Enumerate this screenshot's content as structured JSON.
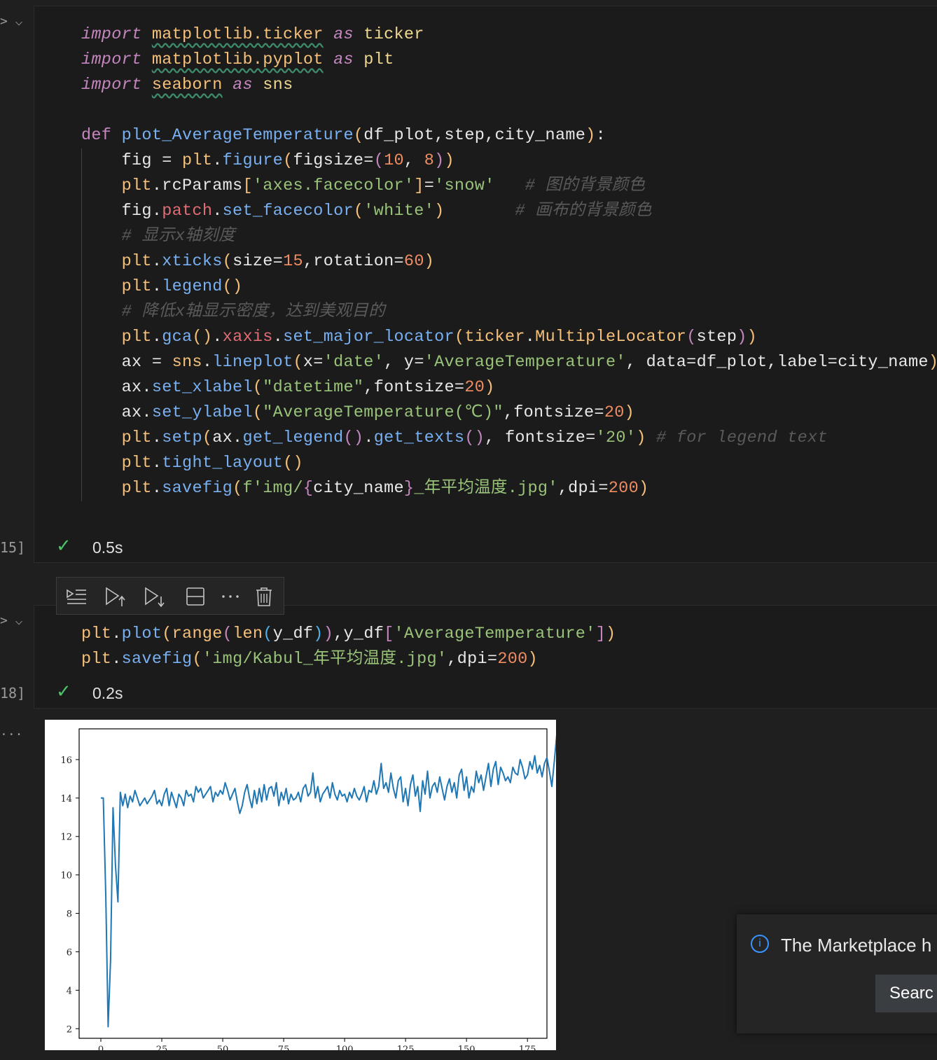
{
  "cell1": {
    "exec_count": "15]",
    "duration": "0.5s",
    "lines": [
      [
        [
          "kw",
          "import"
        ],
        [
          "var",
          " "
        ],
        [
          "mod",
          "matplotlib.ticker"
        ],
        [
          "var",
          " "
        ],
        [
          "kw",
          "as"
        ],
        [
          "var",
          " "
        ],
        [
          "alias",
          "ticker"
        ]
      ],
      [
        [
          "kw",
          "import"
        ],
        [
          "var",
          " "
        ],
        [
          "mod",
          "matplotlib.pyplot"
        ],
        [
          "var",
          " "
        ],
        [
          "kw",
          "as"
        ],
        [
          "var",
          " "
        ],
        [
          "alias",
          "plt"
        ]
      ],
      [
        [
          "kw",
          "import"
        ],
        [
          "var",
          " "
        ],
        [
          "mod",
          "seaborn"
        ],
        [
          "var",
          " "
        ],
        [
          "kw",
          "as"
        ],
        [
          "var",
          " "
        ],
        [
          "alias",
          "sns"
        ]
      ],
      [],
      [
        [
          "def",
          "def"
        ],
        [
          "var",
          " "
        ],
        [
          "fn",
          "plot_AverageTemperature"
        ],
        [
          "br1",
          "("
        ],
        [
          "var",
          "df_plot,step,city_name"
        ],
        [
          "br1",
          ")"
        ],
        [
          "var",
          ":"
        ]
      ],
      [
        [
          "var",
          "    fig = "
        ],
        [
          "obj",
          "plt"
        ],
        [
          "var",
          "."
        ],
        [
          "fn",
          "figure"
        ],
        [
          "br1",
          "("
        ],
        [
          "var",
          "figsize="
        ],
        [
          "br2",
          "("
        ],
        [
          "num",
          "10"
        ],
        [
          "var",
          ", "
        ],
        [
          "num",
          "8"
        ],
        [
          "br2",
          ")"
        ],
        [
          "br1",
          ")"
        ]
      ],
      [
        [
          "var",
          "    "
        ],
        [
          "obj",
          "plt"
        ],
        [
          "var",
          ".rcParams"
        ],
        [
          "br1",
          "["
        ],
        [
          "str",
          "'axes.facecolor'"
        ],
        [
          "br1",
          "]"
        ],
        [
          "var",
          "="
        ],
        [
          "str",
          "'snow'"
        ],
        [
          "var",
          "   "
        ],
        [
          "cm",
          "# 图的背景颜色"
        ]
      ],
      [
        [
          "var",
          "    fig."
        ],
        [
          "attr",
          "patch"
        ],
        [
          "var",
          "."
        ],
        [
          "fn",
          "set_facecolor"
        ],
        [
          "br1",
          "("
        ],
        [
          "str",
          "'white'"
        ],
        [
          "br1",
          ")"
        ],
        [
          "var",
          "       "
        ],
        [
          "cm",
          "# 画布的背景颜色"
        ]
      ],
      [
        [
          "var",
          "    "
        ],
        [
          "cm",
          "# 显示x轴刻度"
        ]
      ],
      [
        [
          "var",
          "    "
        ],
        [
          "obj",
          "plt"
        ],
        [
          "var",
          "."
        ],
        [
          "fn",
          "xticks"
        ],
        [
          "br1",
          "("
        ],
        [
          "var",
          "size="
        ],
        [
          "num",
          "15"
        ],
        [
          "var",
          ",rotation="
        ],
        [
          "num",
          "60"
        ],
        [
          "br1",
          ")"
        ]
      ],
      [
        [
          "var",
          "    "
        ],
        [
          "obj",
          "plt"
        ],
        [
          "var",
          "."
        ],
        [
          "fn",
          "legend"
        ],
        [
          "br1",
          "()"
        ]
      ],
      [
        [
          "var",
          "    "
        ],
        [
          "cm",
          "# 降低x轴显示密度，达到美观目的"
        ]
      ],
      [
        [
          "var",
          "    "
        ],
        [
          "obj",
          "plt"
        ],
        [
          "var",
          "."
        ],
        [
          "fn",
          "gca"
        ],
        [
          "br1",
          "()"
        ],
        [
          "var",
          "."
        ],
        [
          "attr",
          "xaxis"
        ],
        [
          "var",
          "."
        ],
        [
          "fn",
          "set_major_locator"
        ],
        [
          "br1",
          "("
        ],
        [
          "obj",
          "ticker"
        ],
        [
          "var",
          "."
        ],
        [
          "obj",
          "MultipleLocator"
        ],
        [
          "br2",
          "("
        ],
        [
          "var",
          "step"
        ],
        [
          "br2",
          ")"
        ],
        [
          "br1",
          ")"
        ]
      ],
      [
        [
          "var",
          "    ax = "
        ],
        [
          "obj",
          "sns"
        ],
        [
          "var",
          "."
        ],
        [
          "fn",
          "lineplot"
        ],
        [
          "br1",
          "("
        ],
        [
          "var",
          "x="
        ],
        [
          "str",
          "'date'"
        ],
        [
          "var",
          ", y="
        ],
        [
          "str",
          "'AverageTemperature'"
        ],
        [
          "var",
          ", data=df_plot,label=city_name"
        ],
        [
          "br1",
          ")"
        ]
      ],
      [
        [
          "var",
          "    ax."
        ],
        [
          "fn",
          "set_xlabel"
        ],
        [
          "br1",
          "("
        ],
        [
          "str",
          "\"datetime\""
        ],
        [
          "var",
          ",fontsize="
        ],
        [
          "num",
          "20"
        ],
        [
          "br1",
          ")"
        ]
      ],
      [
        [
          "var",
          "    ax."
        ],
        [
          "fn",
          "set_ylabel"
        ],
        [
          "br1",
          "("
        ],
        [
          "str",
          "\"AverageTemperature(℃)\""
        ],
        [
          "var",
          ",fontsize="
        ],
        [
          "num",
          "20"
        ],
        [
          "br1",
          ")"
        ]
      ],
      [
        [
          "var",
          "    "
        ],
        [
          "obj",
          "plt"
        ],
        [
          "var",
          "."
        ],
        [
          "fn",
          "setp"
        ],
        [
          "br1",
          "("
        ],
        [
          "var",
          "ax."
        ],
        [
          "fn",
          "get_legend"
        ],
        [
          "br2",
          "()"
        ],
        [
          "var",
          "."
        ],
        [
          "fn",
          "get_texts"
        ],
        [
          "br2",
          "()"
        ],
        [
          "var",
          ", fontsize="
        ],
        [
          "str",
          "'20'"
        ],
        [
          "br1",
          ")"
        ],
        [
          "var",
          " "
        ],
        [
          "cm",
          "# for legend text"
        ]
      ],
      [
        [
          "var",
          "    "
        ],
        [
          "obj",
          "plt"
        ],
        [
          "var",
          "."
        ],
        [
          "fn",
          "tight_layout"
        ],
        [
          "br1",
          "()"
        ]
      ],
      [
        [
          "var",
          "    "
        ],
        [
          "obj",
          "plt"
        ],
        [
          "var",
          "."
        ],
        [
          "fn",
          "savefig"
        ],
        [
          "br1",
          "("
        ],
        [
          "str",
          "f'img/"
        ],
        [
          "br2",
          "{"
        ],
        [
          "var",
          "city_name"
        ],
        [
          "br2",
          "}"
        ],
        [
          "str",
          "_年平均温度.jpg'"
        ],
        [
          "var",
          ",dpi="
        ],
        [
          "num",
          "200"
        ],
        [
          "br1",
          ")"
        ]
      ]
    ]
  },
  "cell2": {
    "exec_count": "18]",
    "duration": "0.2s",
    "lines": [
      [
        [
          "obj",
          "plt"
        ],
        [
          "var",
          "."
        ],
        [
          "fn",
          "plot"
        ],
        [
          "br1",
          "("
        ],
        [
          "obj",
          "range"
        ],
        [
          "br2",
          "("
        ],
        [
          "obj",
          "len"
        ],
        [
          "br3",
          "("
        ],
        [
          "var",
          "y_df"
        ],
        [
          "br3",
          ")"
        ],
        [
          "br2",
          ")"
        ],
        [
          "var",
          ",y_df"
        ],
        [
          "br2",
          "["
        ],
        [
          "str",
          "'AverageTemperature'"
        ],
        [
          "br2",
          "]"
        ],
        [
          "br1",
          ")"
        ]
      ],
      [
        [
          "obj",
          "plt"
        ],
        [
          "var",
          "."
        ],
        [
          "fn",
          "savefig"
        ],
        [
          "br1",
          "("
        ],
        [
          "str",
          "'img/Kabul_年平均温度.jpg'"
        ],
        [
          "var",
          ",dpi="
        ],
        [
          "num",
          "200"
        ],
        [
          "br1",
          ")"
        ]
      ]
    ]
  },
  "toolbar": {
    "icons": [
      "run-by-line-icon",
      "run-above-icon",
      "run-below-icon",
      "split-cell-icon",
      "more-icon",
      "delete-icon"
    ]
  },
  "output": {
    "ellipsis": "..."
  },
  "chart_data": {
    "type": "line",
    "x_range": [
      0,
      180
    ],
    "ylim": [
      1.5,
      17.6
    ],
    "xticks": [
      0,
      25,
      50,
      75,
      100,
      125,
      150,
      175
    ],
    "yticks": [
      2,
      4,
      6,
      8,
      10,
      12,
      14,
      16
    ],
    "line_color": "#1f77b4",
    "y": [
      14.0,
      14.0,
      9.0,
      2.1,
      5.6,
      13.5,
      10.5,
      8.6,
      14.3,
      13.6,
      14.2,
      13.5,
      14.1,
      13.8,
      14.4,
      14.0,
      13.6,
      13.8,
      14.0,
      13.7,
      13.9,
      14.1,
      14.4,
      13.7,
      13.9,
      13.6,
      14.2,
      14.5,
      13.6,
      14.3,
      13.9,
      13.5,
      14.2,
      14.0,
      13.6,
      14.4,
      14.1,
      14.2,
      13.8,
      14.6,
      14.3,
      14.5,
      14.0,
      14.2,
      14.4,
      14.6,
      13.8,
      14.3,
      14.1,
      14.4,
      14.2,
      14.8,
      14.4,
      13.9,
      14.2,
      14.5,
      13.8,
      13.2,
      13.6,
      14.3,
      14.7,
      14.0,
      13.5,
      14.4,
      13.7,
      14.5,
      13.8,
      14.7,
      13.9,
      14.5,
      14.6,
      14.1,
      14.8,
      13.6,
      14.3,
      13.9,
      14.5,
      13.7,
      14.2,
      13.9,
      14.0,
      14.3,
      13.8,
      14.5,
      14.7,
      14.1,
      14.3,
      15.3,
      14.0,
      14.6,
      13.8,
      14.2,
      14.4,
      14.6,
      14.0,
      14.8,
      14.2,
      13.9,
      14.4,
      14.1,
      14.2,
      13.8,
      14.3,
      14.0,
      14.5,
      14.1,
      13.9,
      14.2,
      14.6,
      13.8,
      14.4,
      14.3,
      14.9,
      14.2,
      14.6,
      15.8,
      14.5,
      14.8,
      14.3,
      15.3,
      14.5,
      14.0,
      14.9,
      15.1,
      13.8,
      14.5,
      13.6,
      14.7,
      15.2,
      14.1,
      14.6,
      13.3,
      14.9,
      14.2,
      15.4,
      14.0,
      14.6,
      14.8,
      14.3,
      15.1,
      14.5,
      13.9,
      14.6,
      15.0,
      14.3,
      14.8,
      14.0,
      15.2,
      15.5,
      14.4,
      15.1,
      14.0,
      14.6,
      14.3,
      15.4,
      14.8,
      15.2,
      14.4,
      15.1,
      15.8,
      14.6,
      15.5,
      15.9,
      14.7,
      15.6,
      15.3,
      14.9,
      15.1,
      14.8,
      15.6,
      15.3,
      15.2,
      16.0,
      15.6,
      15.0,
      15.2,
      15.9,
      15.5,
      16.2,
      15.3,
      15.7,
      15.1,
      15.8,
      16.1,
      15.4,
      14.6,
      15.9,
      17.3
    ]
  }
}
